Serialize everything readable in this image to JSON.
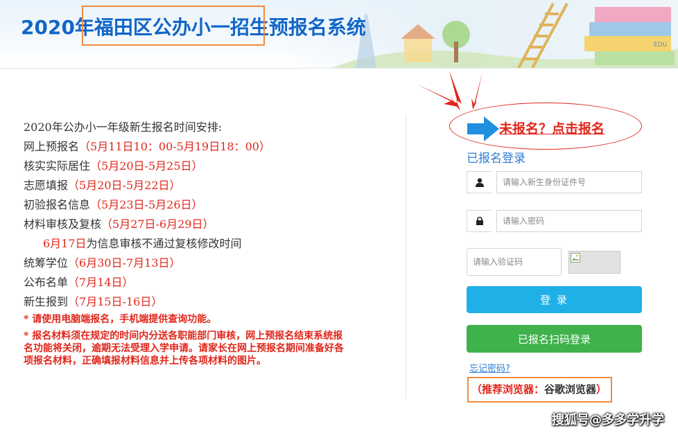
{
  "header": {
    "title": "2020年福田区公办小一招生预报名系统",
    "banner_art_text": "EDU"
  },
  "schedule": {
    "heading": "2020年公办小一年级新生报名时间安排:",
    "items": [
      {
        "label": "网上预报名",
        "date": "（5月11日10：00-5月19日18：00）"
      },
      {
        "label": "核实实际居住",
        "date": "（5月20日-5月25日）"
      },
      {
        "label": "志愿填报",
        "date": "（5月20日-5月22日）"
      },
      {
        "label": "初验报名信息",
        "date": "（5月23日-5月26日）"
      },
      {
        "label": "材料审核及复核",
        "date": "（5月27日-6月29日）"
      },
      {
        "label_red": "6月17日",
        "label": "为信息审核不通过复核修改时间"
      },
      {
        "label": "统筹学位",
        "date": "（6月30日-7月13日）"
      },
      {
        "label": "公布名单",
        "date": "（7月14日）"
      },
      {
        "label": "新生报到",
        "date": "（7月15日-16日）"
      }
    ],
    "notes": [
      "* 请使用电脑端报名，手机端提供查询功能。",
      "* 报名材料须在规定的时间内分送各职能部门审核，网上预报名结束系统报名功能将关闭，逾期无法受理入学申请。请家长在网上预报名期间准备好各项报名材料，正确填报材料信息并上传各项材料的图片。"
    ]
  },
  "login": {
    "register_link": "未报名？点击报名",
    "heading": "已报名登录",
    "id_placeholder": "请输入新生身份证件号",
    "password_placeholder": "请输入密码",
    "captcha_placeholder": "请输入验证码",
    "login_button": "登 录",
    "scan_button": "已报名扫码登录",
    "forgot_link": "忘记密码?",
    "browser_paren_open": "（",
    "browser_label": "推荐浏览器：",
    "browser_name": "谷歌浏览器",
    "browser_paren_close": "）"
  },
  "watermark": "搜狐号@多多学升学",
  "colors": {
    "title": "#1166c8",
    "accent_red": "#e0261b",
    "login_button": "#1fb0e8",
    "scan_button": "#3fb24b",
    "highlight_orange": "#f08a3c"
  },
  "icons": [
    "user-icon",
    "lock-icon",
    "arrow-right-icon",
    "broken-image-icon"
  ]
}
